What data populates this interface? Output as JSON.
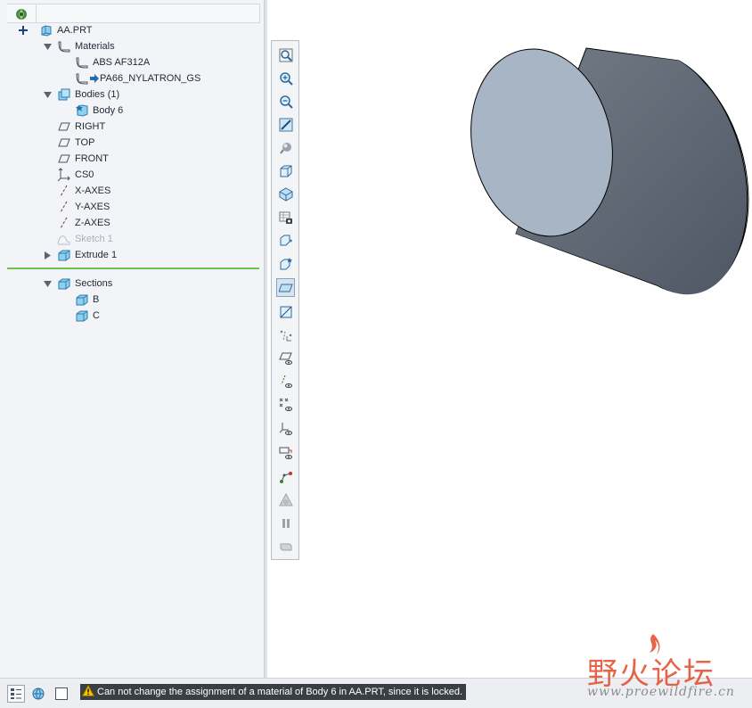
{
  "model_tree": {
    "root": "AA.PRT",
    "materials_label": "Materials",
    "materials": [
      "ABS AF312A",
      "PA66_NYLATRON_GS"
    ],
    "bodies_label": "Bodies (1)",
    "body": "Body 6",
    "features": [
      "RIGHT",
      "TOP",
      "FRONT",
      "CS0",
      "X-AXES",
      "Y-AXES",
      "Z-AXES",
      "Sketch 1",
      "Extrude 1"
    ],
    "sections_label": "Sections",
    "sections": [
      "B",
      "C"
    ]
  },
  "graphics_toolbar": {
    "icons": [
      "zoom-fit-icon",
      "zoom-in-icon",
      "zoom-out-icon",
      "repaint-icon",
      "appearance-icon",
      "display-style-icon",
      "saved-orientations-icon",
      "view-manager-icon",
      "spin-center-icon",
      "annotation-display-icon",
      "section-display-icon",
      "perspective-icon",
      "datum-display-icon",
      "plane-display-icon",
      "axis-display-icon",
      "point-display-icon",
      "csys-display-icon",
      "annotation-plane-icon",
      "connection-display-icon",
      "simulation-display-icon",
      "pause-icon",
      "rewind-icon"
    ],
    "active_index": 10
  },
  "status_bar": {
    "message": "Can not change the assignment of a material of Body 6 in AA.PRT, since it is locked."
  },
  "watermark": {
    "title": "野火论坛",
    "url": "www.proewildfire.cn"
  },
  "colors": {
    "panel_bg": "#f2f4f7",
    "separator_green": "#6cc24a",
    "cylinder_face": "#a8b5c4",
    "cylinder_side_dark": "#4e5763",
    "status_message_bg": "#3a3f44",
    "warning_yellow": "#f2c200"
  }
}
